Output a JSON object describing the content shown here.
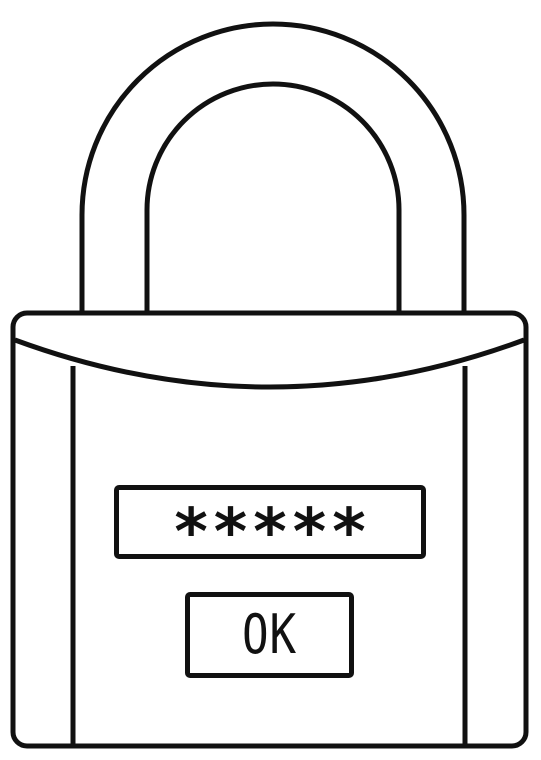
{
  "lock": {
    "icon": "padlock-icon",
    "stroke_color": "#111111",
    "fill_color": "#ffffff"
  },
  "password_field": {
    "value": "*****"
  },
  "ok_button": {
    "label": "OK"
  }
}
